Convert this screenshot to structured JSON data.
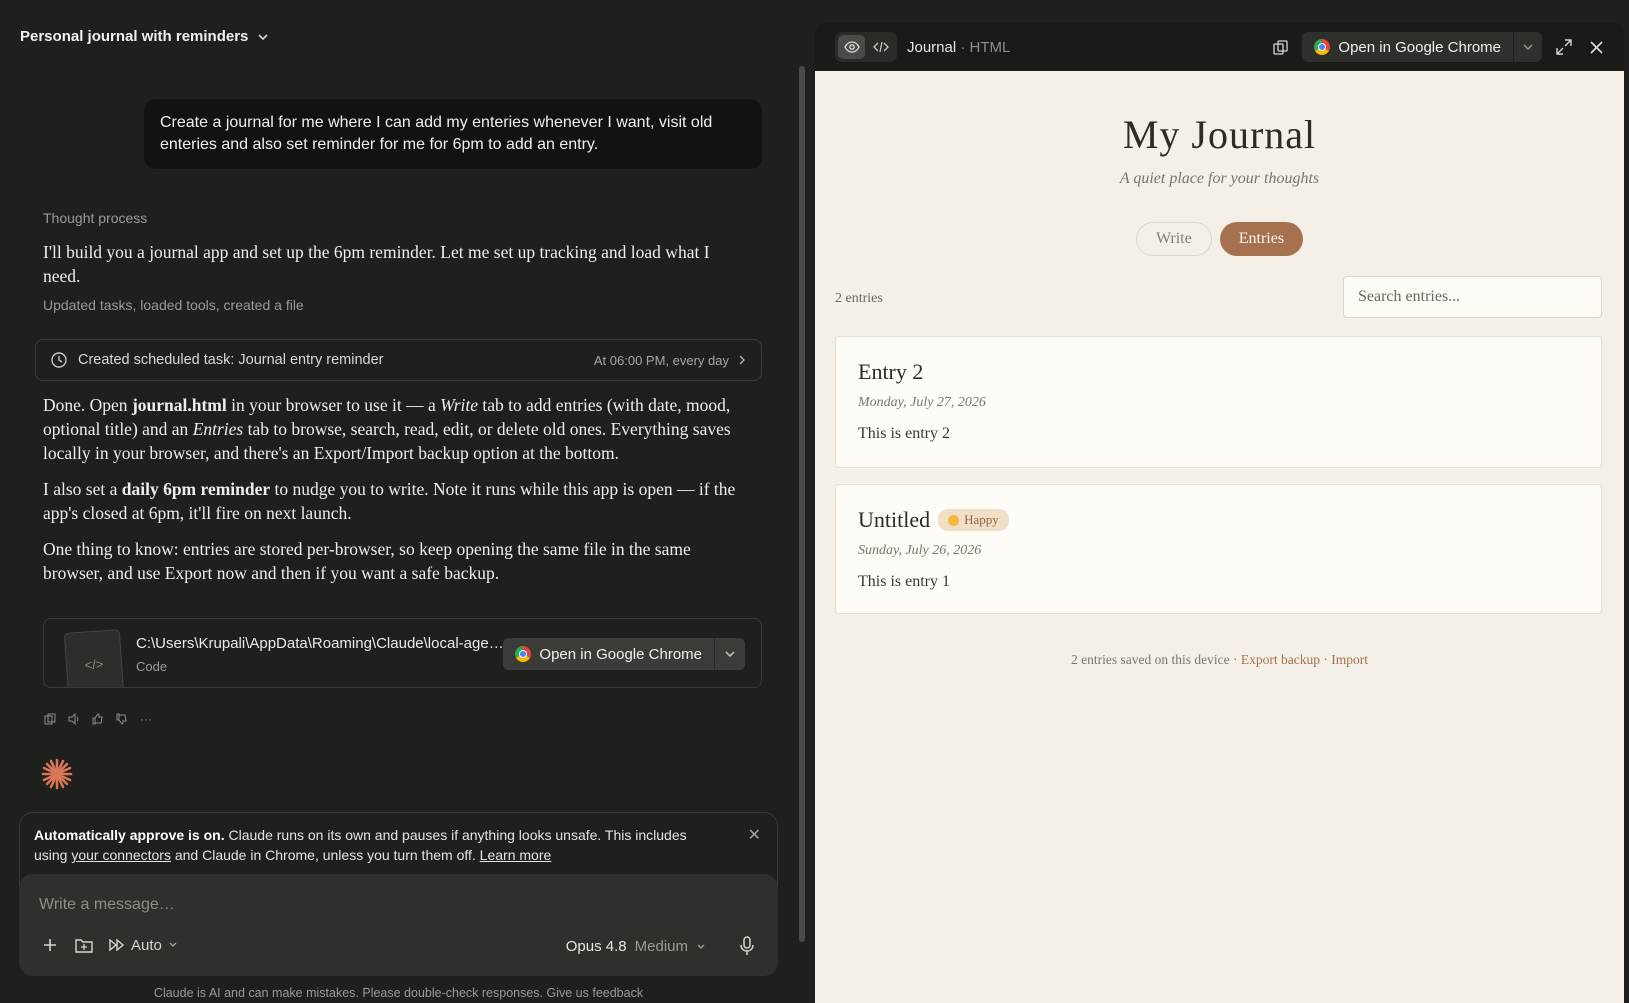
{
  "conversation": {
    "title": "Personal journal with reminders",
    "user_message": "Create a journal for me where I can add my enteries whenever I want, visit old enteries and also set reminder for me for 6pm to add an entry.",
    "thought_label": "Thought process",
    "intro": "I'll build you a journal app and set up the 6pm reminder. Let me set up tracking and load what I need.",
    "tools_line": "Updated tasks, loaded tools, created a file",
    "task_card": {
      "label": "Created scheduled task: Journal entry reminder",
      "schedule": "At 06:00 PM, every day"
    },
    "answer": {
      "p1_a": "Done. Open ",
      "p1_file": "journal.html",
      "p1_b": " in your browser to use it — a ",
      "p1_write": "Write",
      "p1_c": " tab to add entries (with date, mood, optional title) and an ",
      "p1_entries": "Entries",
      "p1_d": " tab to browse, search, read, edit, or delete old ones. Everything saves locally in your browser, and there's an Export/Import backup option at the bottom.",
      "p2_a": "I also set a ",
      "p2_bold": "daily 6pm reminder",
      "p2_b": " to nudge you to write. Note it runs while this app is open — if the app's closed at 6pm, it'll fire on next launch.",
      "p3": "One thing to know: entries are stored per-browser, so keep opening the same file in the same browser, and use Export now and then if you want a safe backup."
    },
    "file_card": {
      "path": "C:\\Users\\Krupali\\AppData\\Roaming\\Claude\\local-agent-mode-sessions\\journal.html",
      "kind": "Code",
      "open_label": "Open in Google Chrome"
    }
  },
  "approve_banner": {
    "bold": "Automatically approve is on.",
    "text_a": " Claude runs on its own and pauses if anything looks unsafe. This includes using ",
    "link_connectors": "your connectors",
    "text_b": " and Claude in Chrome, unless you turn them off. ",
    "link_learn": "Learn more"
  },
  "composer": {
    "placeholder": "Write a message…",
    "mode": "Auto",
    "model": "Opus 4.8",
    "effort": "Medium"
  },
  "disclaimer": "Claude is AI and can make mistakes. Please double-check responses. Give us feedback",
  "preview_bar": {
    "doc_name": "Journal",
    "doc_type": "· HTML",
    "open_label": "Open in Google Chrome"
  },
  "journal": {
    "title": "My Journal",
    "subtitle": "A quiet place for your thoughts",
    "tab_write": "Write",
    "tab_entries": "Entries",
    "count": "2 entries",
    "search_placeholder": "Search entries...",
    "entries": [
      {
        "title": "Entry 2",
        "mood": "",
        "date": "Monday, July 27, 2026",
        "body": "This is entry 2"
      },
      {
        "title": "Untitled",
        "mood": "Happy",
        "date": "Sunday, July 26, 2026",
        "body": "This is entry 1"
      }
    ],
    "footer_text": "2 entries saved on this device · ",
    "footer_export": "Export backup",
    "footer_sep": " · ",
    "footer_import": "Import"
  },
  "colors": {
    "accent": "#a6714f",
    "dark_bg": "#1f1f1d",
    "paper_bg": "#f4f0e8"
  }
}
